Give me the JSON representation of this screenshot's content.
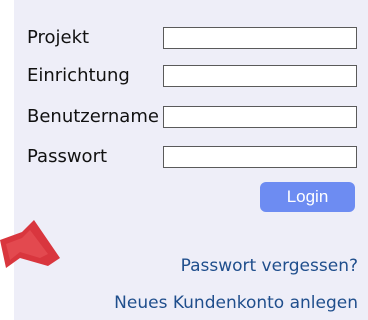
{
  "form": {
    "fields": [
      {
        "label": "Projekt",
        "value": ""
      },
      {
        "label": "Einrichtung",
        "value": ""
      },
      {
        "label": "Benutzername",
        "value": ""
      },
      {
        "label": "Passwort",
        "value": ""
      }
    ],
    "login_label": "Login"
  },
  "links": {
    "forgot_password": "Passwort vergessen?",
    "new_account": "Neues Kundenkonto anlegen"
  },
  "colors": {
    "panel_background": "#eeeef8",
    "button": "#6d8cf2",
    "link": "#1f4e8c",
    "arrow": "#d9363e"
  },
  "icons": {
    "pointer_arrow": "red-arrow-icon"
  }
}
